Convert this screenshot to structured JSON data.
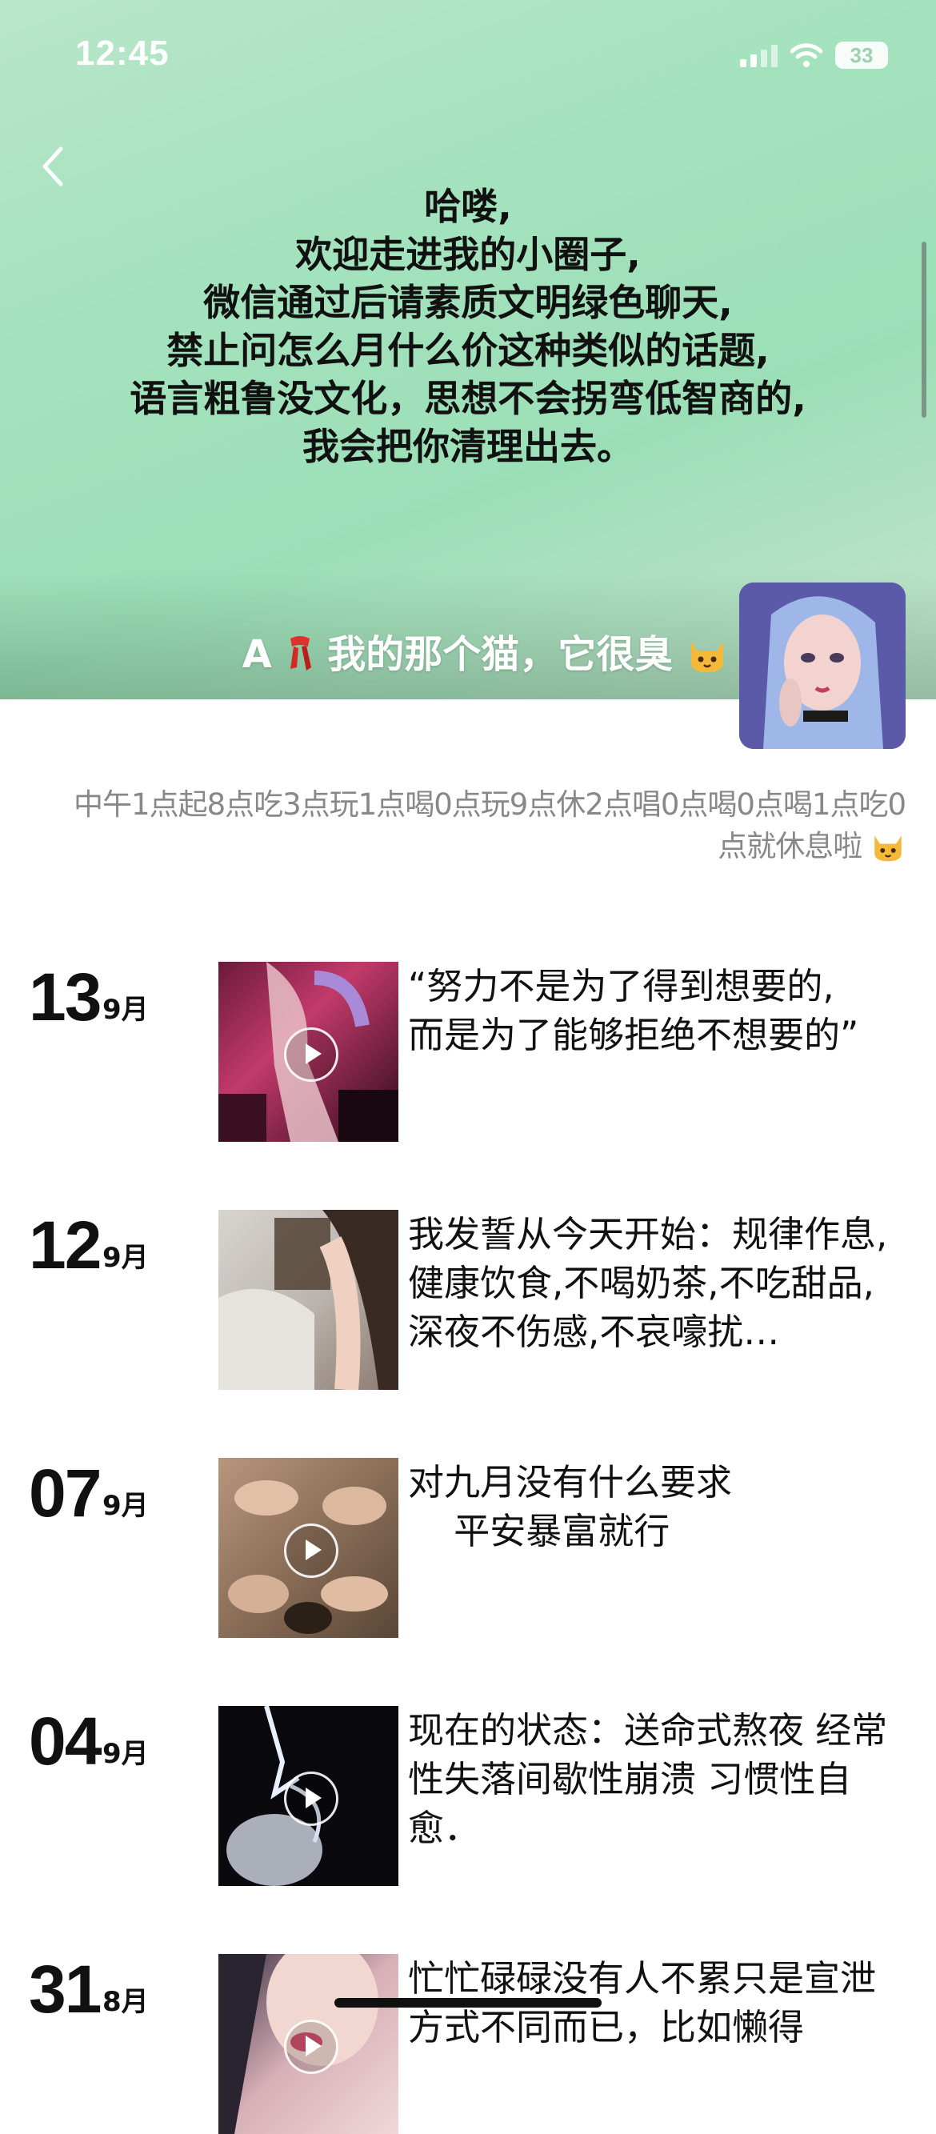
{
  "status_bar": {
    "time": "12:45",
    "battery": "33"
  },
  "cover": {
    "notice_lines": [
      "哈喽,",
      "欢迎走进我的小圈子,",
      "微信通过后请素质文明绿色聊天,",
      "禁止问怎么月什么价这种类似的话题,",
      "语言粗鲁没文化，思想不会拐弯低智商的,",
      "我会把你清理出去。"
    ],
    "signature_prefix": "A",
    "signature_text": "我的那个猫，它很臭"
  },
  "bio": "中午1点起8点吃3点玩1点喝0点玩9点休2点唱0点喝0点喝1点吃0点就休息啦",
  "posts": [
    {
      "day": "13",
      "month": "9月",
      "text": "“努力不是为了得到想要的,\n而是为了能够拒绝不想要的”",
      "video": true
    },
    {
      "day": "12",
      "month": "9月",
      "text": "我发誓从今天开始：规律作息,健康饮食,不喝奶茶,不吃甜品,深夜不伤感,不哀嚎扰…",
      "video": false
    },
    {
      "day": "07",
      "month": "9月",
      "text": "对九月没有什么要求\n    平安暴富就行",
      "video": true
    },
    {
      "day": "04",
      "month": "9月",
      "text": "现在的状态：送命式熬夜 经常性失落间歇性崩溃 习惯性自愈．",
      "video": true
    },
    {
      "day": "31",
      "month": "8月",
      "text": "忙忙碌碌没有人不累只是宣泄方式不同而已，比如懒得",
      "video": true
    }
  ]
}
